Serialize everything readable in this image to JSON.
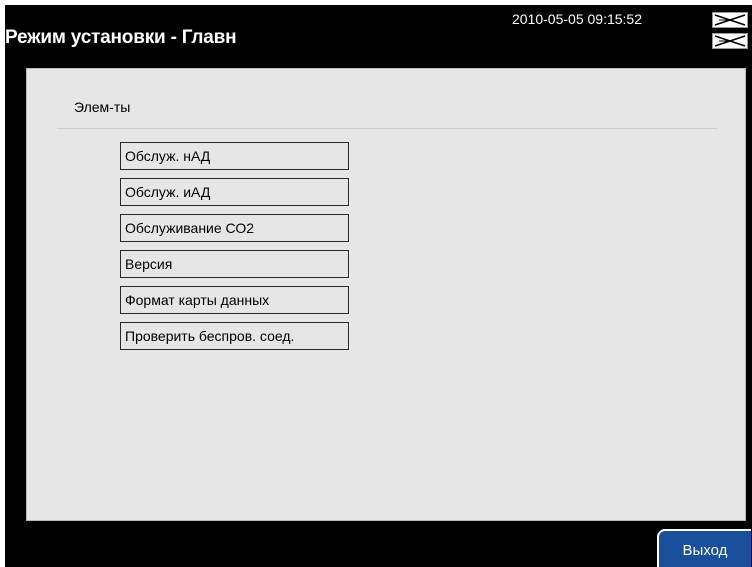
{
  "header": {
    "title": "Режим установки - Главн",
    "datetime": "2010-05-05 09:15:52",
    "icons": [
      "network-status-icon",
      "connection-status-icon"
    ]
  },
  "main": {
    "section_label": "Элем-ты",
    "menu_items": [
      {
        "label": "Обслуж. нАД"
      },
      {
        "label": "Обслуж. иАД"
      },
      {
        "label": "Обслуживание СО2"
      },
      {
        "label": "Версия"
      },
      {
        "label": "Формат карты данных"
      },
      {
        "label": "Проверить беспров. соед."
      }
    ]
  },
  "footer": {
    "exit_label": "Выход"
  },
  "colors": {
    "background": "#000000",
    "panel": "#e6e6e6",
    "exit_button": "#1a4f9c"
  }
}
